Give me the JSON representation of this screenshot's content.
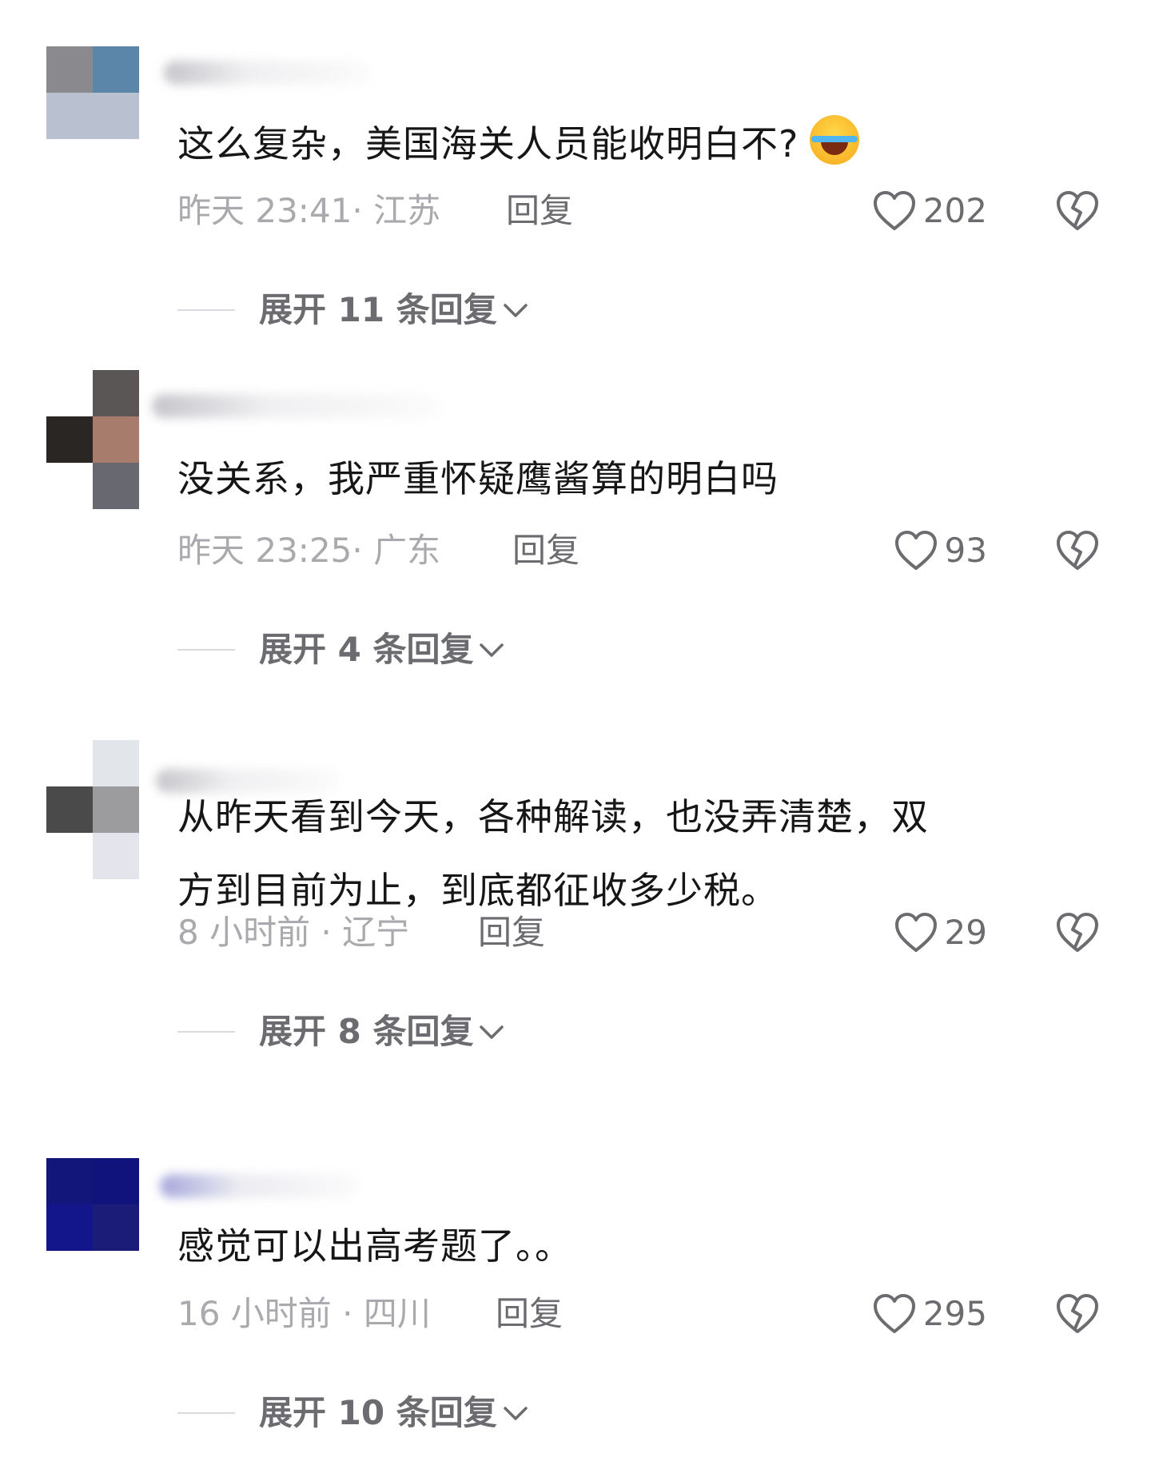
{
  "comments": [
    {
      "avatar_colors": [
        "#8a8a8e",
        "#5b86aa",
        "#b9c1d0",
        "#b9c1d0"
      ],
      "text_lines": [
        "这么复杂，美国海关人员能收明白不?"
      ],
      "has_emoji": true,
      "emoji_icon": "laugh-cry-emoji",
      "time": "昨天 23:41",
      "location": "江苏",
      "meta": "昨天 23:41· 江苏",
      "reply_label": "回复",
      "likes": "202",
      "expand_label": "展开 11 条回复"
    },
    {
      "avatar_colors": [
        "#ffffff",
        "#5a5656",
        "#2a2624",
        "#a87c6c",
        "#ffffff",
        "#676870"
      ],
      "text_lines": [
        "没关系，我严重怀疑鹰酱算的明白吗"
      ],
      "has_emoji": false,
      "time": "昨天 23:25",
      "location": "广东",
      "meta": "昨天 23:25· 广东",
      "reply_label": "回复",
      "likes": "93",
      "expand_label": "展开 4 条回复"
    },
    {
      "avatar_colors": [
        "#ffffff",
        "#e2e6ea",
        "#4a4a4a",
        "#9c9c9e",
        "#ffffff",
        "#e4e4ec"
      ],
      "text_lines": [
        "从昨天看到今天，各种解读，也没弄清楚，双",
        "方到目前为止，到底都征收多少税。"
      ],
      "has_emoji": false,
      "time": "8 小时前",
      "location": "辽宁",
      "meta": "8 小时前 · 辽宁",
      "reply_label": "回复",
      "likes": "29",
      "expand_label": "展开 8 条回复"
    },
    {
      "avatar_colors": [
        "#12157a",
        "#10137c",
        "#12168a",
        "#1a1c78"
      ],
      "text_lines": [
        "感觉可以出高考题了。。"
      ],
      "has_emoji": false,
      "time": "16 小时前",
      "location": "四川",
      "meta": "16 小时前 · 四川",
      "reply_label": "回复",
      "likes": "295",
      "expand_label": "展开 10 条回复"
    }
  ],
  "icons": {
    "like": "heart-outline-icon",
    "dislike": "broken-heart-icon",
    "expand": "chevron-down-icon"
  },
  "colors": {
    "text": "#161616",
    "meta": "#a9a9ae",
    "secondary": "#6b6b70"
  }
}
